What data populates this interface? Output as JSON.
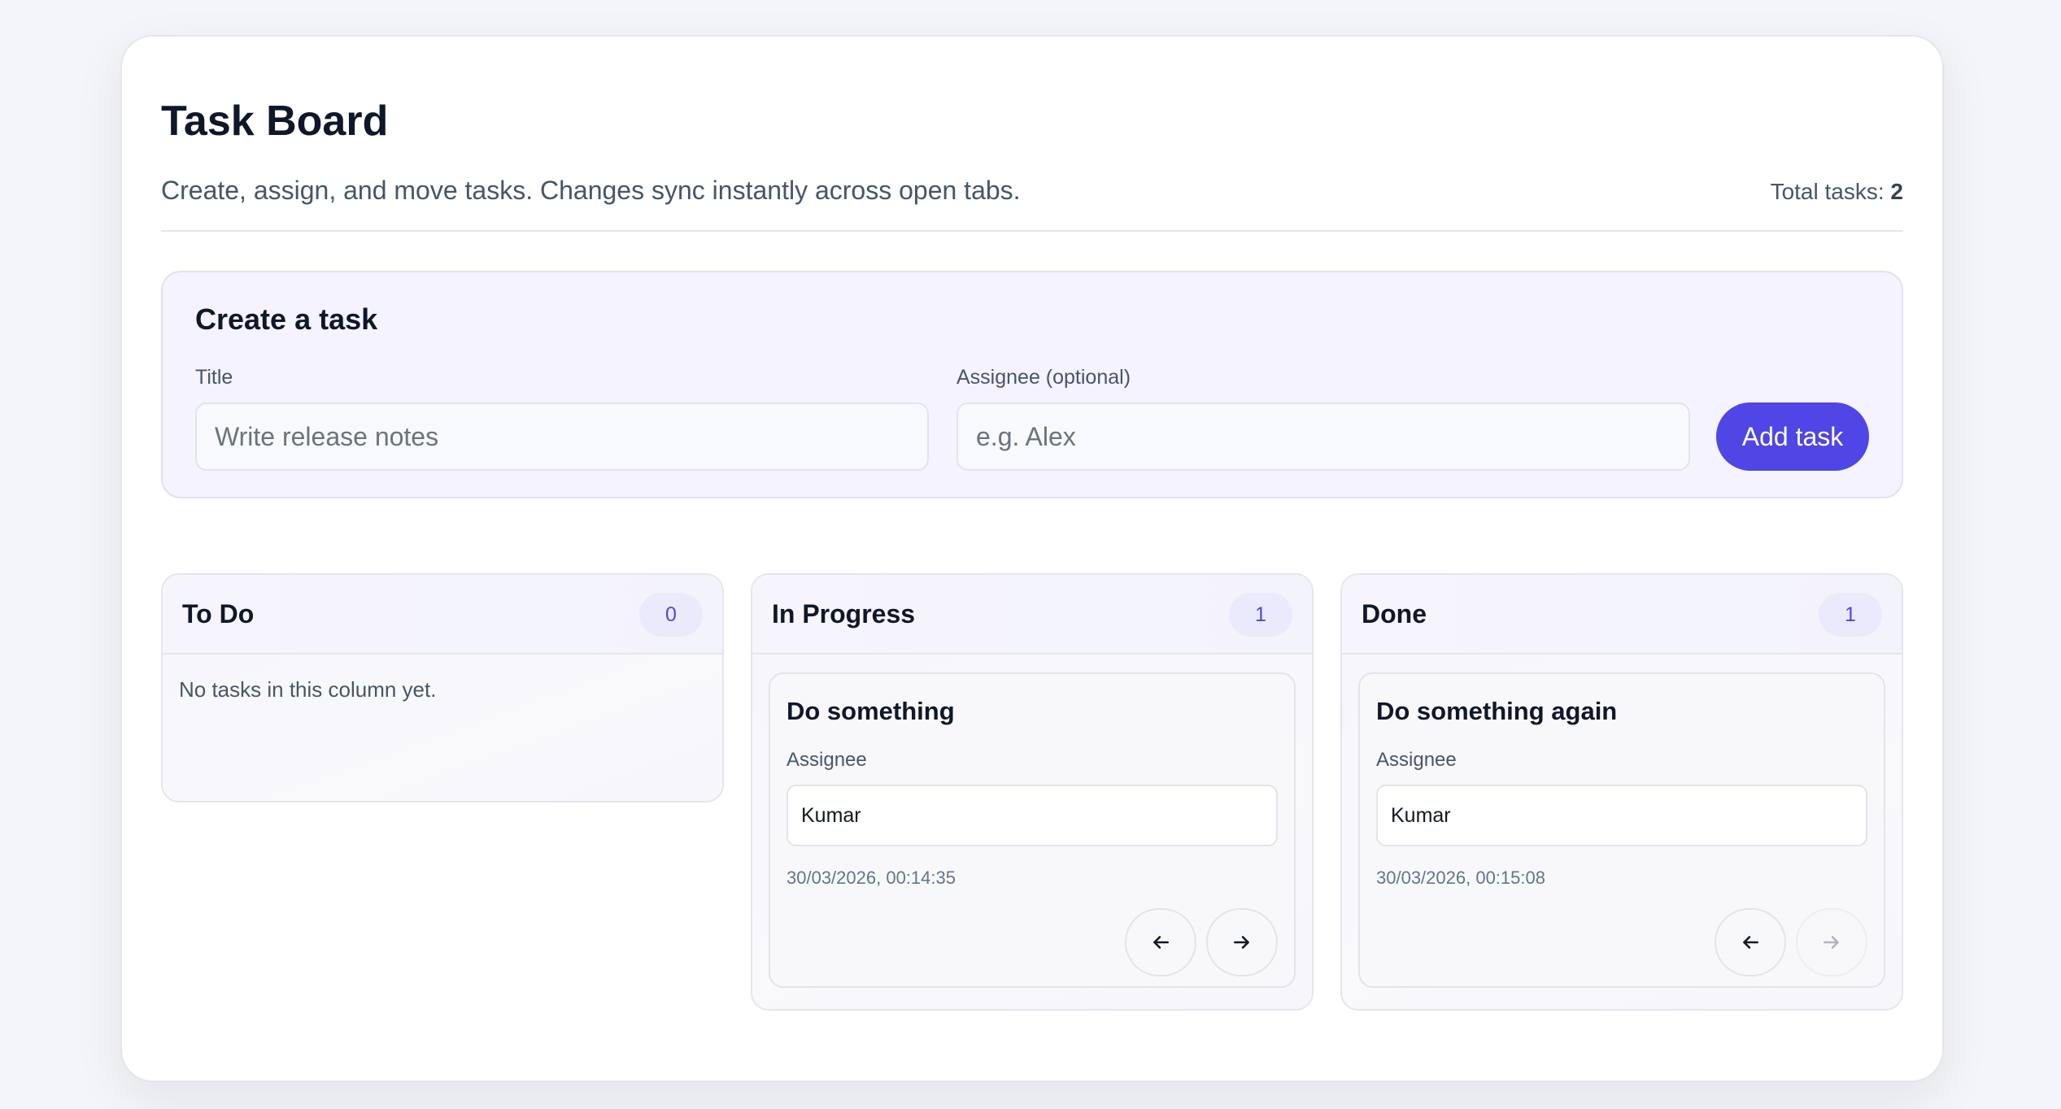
{
  "header": {
    "title": "Task Board",
    "subtitle": "Create, assign, and move tasks. Changes sync instantly across open tabs.",
    "total_label": "Total tasks:",
    "total_count": "2"
  },
  "create": {
    "heading": "Create a task",
    "title_label": "Title",
    "title_placeholder": "Write release notes",
    "assignee_label": "Assignee (optional)",
    "assignee_placeholder": "e.g. Alex",
    "add_label": "Add task"
  },
  "columns": [
    {
      "title": "To Do",
      "count": "0",
      "empty_text": "No tasks in this column yet."
    },
    {
      "title": "In Progress",
      "count": "1",
      "task": {
        "title": "Do something",
        "assignee_label": "Assignee",
        "assignee": "Kumar",
        "timestamp": "30/03/2026, 00:14:35"
      }
    },
    {
      "title": "Done",
      "count": "1",
      "task": {
        "title": "Do something again",
        "assignee_label": "Assignee",
        "assignee": "Kumar",
        "timestamp": "30/03/2026, 00:15:08"
      }
    }
  ],
  "icons": {
    "prev": "arrow-left-icon",
    "next": "arrow-right-icon"
  },
  "colors": {
    "accent": "#4f46e5",
    "panel_bg": "#f4f3ff",
    "pill_bg": "#ebeafd"
  }
}
